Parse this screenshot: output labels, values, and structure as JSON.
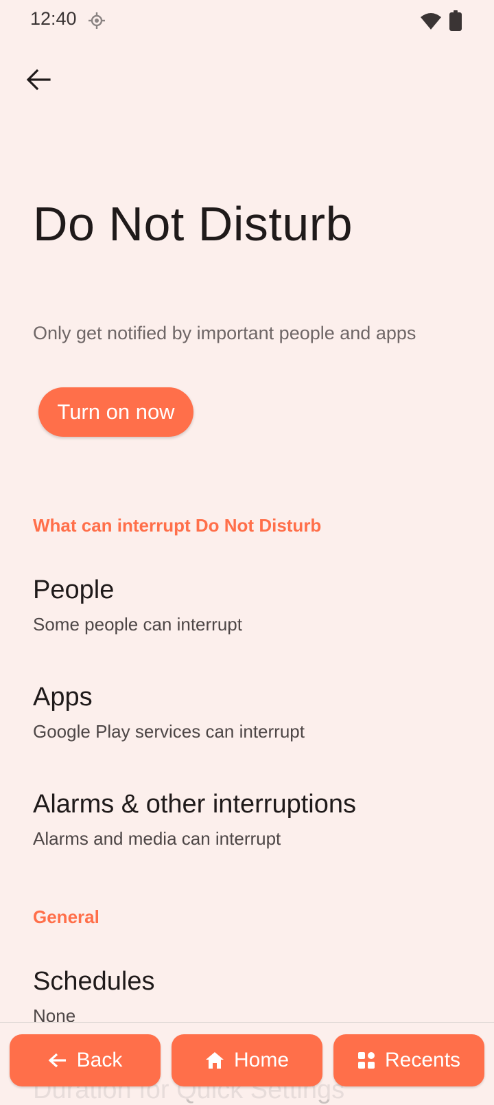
{
  "status_bar": {
    "time": "12:40",
    "location_icon": "location-icon",
    "wifi_icon": "wifi-icon",
    "battery_icon": "battery-icon"
  },
  "header": {
    "back_icon": "arrow-back-icon"
  },
  "page": {
    "title": "Do Not Disturb",
    "subtitle": "Only get notified by important people and apps",
    "turn_on_label": "Turn on now"
  },
  "sections": [
    {
      "header": "What can interrupt Do Not Disturb",
      "items": [
        {
          "title": "People",
          "summary": "Some people can interrupt"
        },
        {
          "title": "Apps",
          "summary": "Google Play services can interrupt"
        },
        {
          "title": "Alarms & other interruptions",
          "summary": "Alarms and media can interrupt"
        }
      ]
    },
    {
      "header": "General",
      "items": [
        {
          "title": "Schedules",
          "summary": "None"
        },
        {
          "title": "Duration for Quick Settings",
          "summary": ""
        }
      ]
    }
  ],
  "nav": {
    "back_label": "Back",
    "home_label": "Home",
    "recents_label": "Recents"
  },
  "colors": {
    "background": "#fcefec",
    "accent": "#ff6f4a",
    "text_primary": "#1f1a1a",
    "text_secondary": "#6e6666"
  }
}
